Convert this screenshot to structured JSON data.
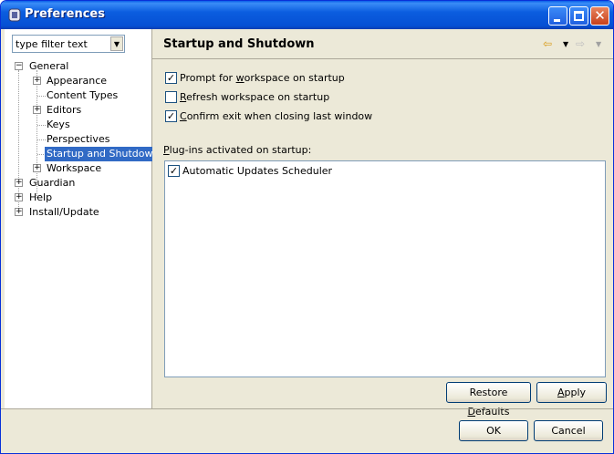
{
  "window": {
    "title": "Preferences"
  },
  "filter": {
    "text": "type filter text"
  },
  "tree": {
    "general": "General",
    "appearance": "Appearance",
    "content_types": "Content Types",
    "editors": "Editors",
    "keys": "Keys",
    "perspectives": "Perspectives",
    "startup": "Startup and Shutdown",
    "workspace": "Workspace",
    "guardian": "Guardian",
    "help": "Help",
    "install_update": "Install/Update"
  },
  "page": {
    "title": "Startup and Shutdown",
    "options": [
      {
        "label_pre": "Prompt for ",
        "label_u": "w",
        "label_post": "orkspace on startup",
        "checked": true
      },
      {
        "label_pre": "",
        "label_u": "R",
        "label_post": "efresh workspace on startup",
        "checked": false
      },
      {
        "label_pre": "",
        "label_u": "C",
        "label_post": "onfirm exit when closing last window",
        "checked": true
      }
    ],
    "plugins_label_u": "P",
    "plugins_label_post": "lug-ins activated on startup:",
    "plugins": [
      {
        "name": "Automatic Updates Scheduler",
        "checked": true
      }
    ],
    "restore_pre": "Restore ",
    "restore_u": "D",
    "restore_post": "efaults",
    "apply_pre": "",
    "apply_u": "A",
    "apply_post": "pply"
  },
  "dialog": {
    "ok": "OK",
    "cancel": "Cancel"
  },
  "colors": {
    "titlebar": "#0650d4",
    "selection": "#316ac5",
    "nav_arrow": "#d89a16"
  }
}
